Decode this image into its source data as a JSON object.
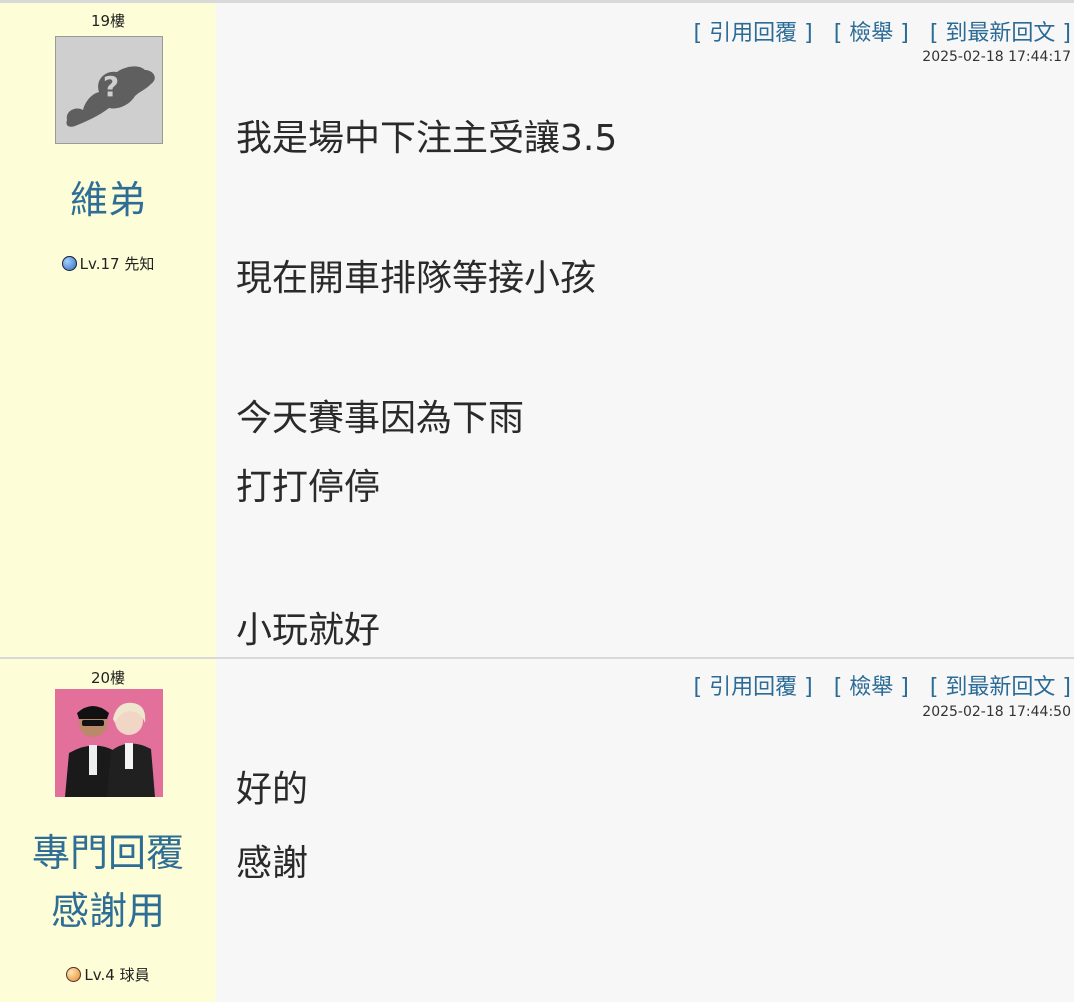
{
  "actions": {
    "quote_reply": "[ 引用回覆 ]",
    "report": "[ 檢舉 ]",
    "latest": "[ 到最新回文 ]"
  },
  "posts": [
    {
      "floor": "19樓",
      "avatar_icon": "unknown-user-avatar-icon",
      "username": "維弟",
      "level": "Lv.17 先知",
      "level_icon": "blue-planet-icon",
      "timestamp": "2025-02-18 17:44:17",
      "lines": [
        "我是場中下注主受讓3.5",
        "現在開車排隊等接小孩",
        "今天賽事因為下雨",
        "打打停停",
        "小玩就好"
      ]
    },
    {
      "floor": "20樓",
      "avatar_icon": "photo-avatar-two-people",
      "username_lines": [
        "專門回覆",
        "感謝用"
      ],
      "level": "Lv.4 球員",
      "level_icon": "orange-planet-icon",
      "timestamp": "2025-02-18 17:44:50",
      "lines": [
        "好的",
        "感謝"
      ]
    }
  ],
  "colors": {
    "sidebar_bg": "#fdfdd7",
    "link": "#2b6b96",
    "username": "#2e6e96"
  }
}
